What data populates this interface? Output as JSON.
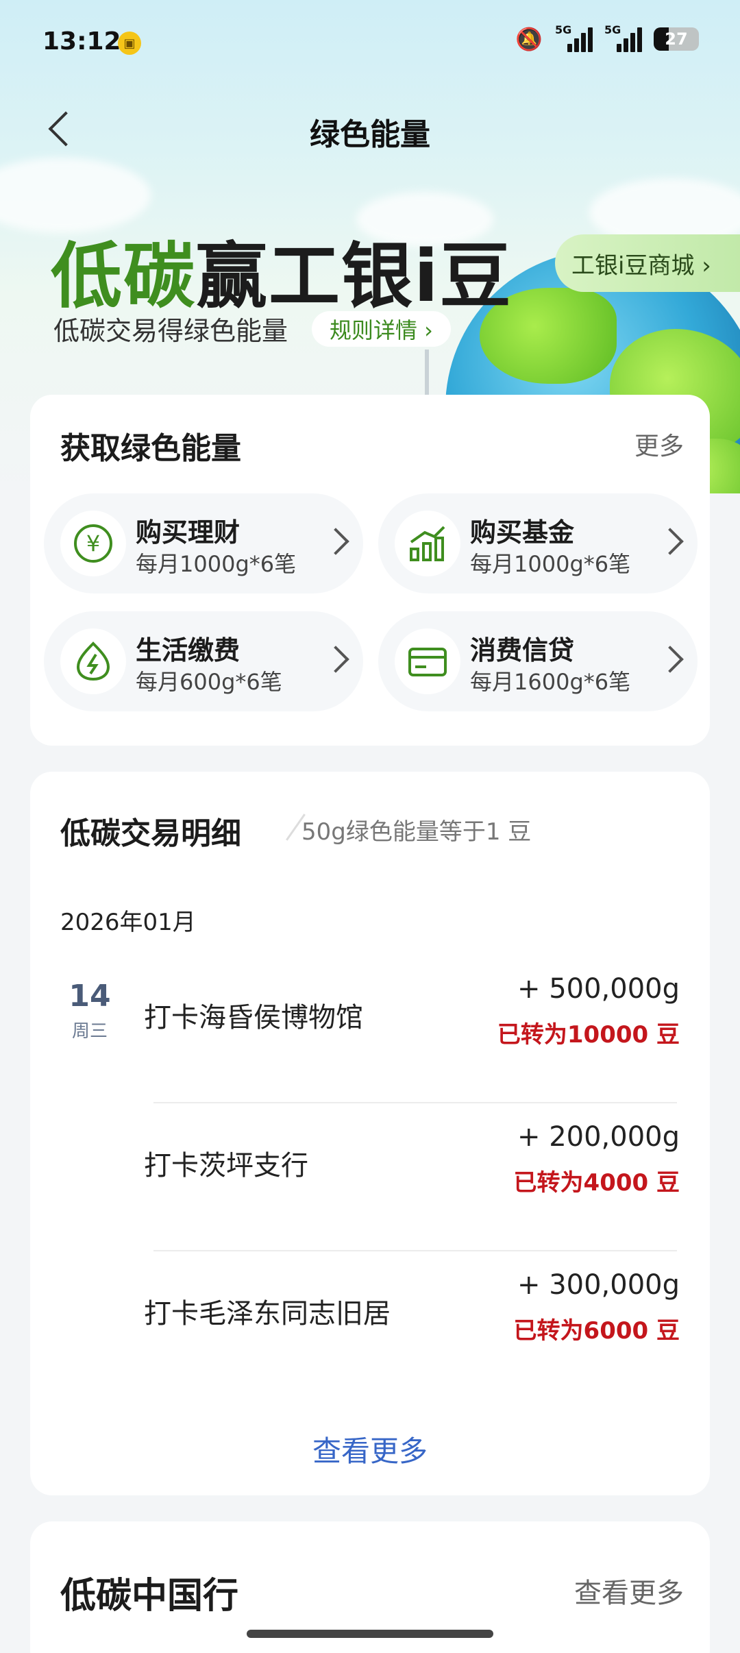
{
  "status_bar": {
    "time": "13:12",
    "network1": "5G",
    "network2": "5G",
    "battery": "27"
  },
  "nav": {
    "title": "绿色能量"
  },
  "hero": {
    "headline_green": "低碳",
    "headline_dark": "赢工银i豆",
    "subtitle": "低碳交易得绿色能量",
    "rules_label": "规则详情 ›",
    "shop_label": "工银i豆商城 ›"
  },
  "earn": {
    "title": "获取绿色能量",
    "more": "更多",
    "tasks": [
      {
        "name": "购买理财",
        "desc": "每月1000g*6笔",
        "icon": "yen-icon"
      },
      {
        "name": "购买基金",
        "desc": "每月1000g*6笔",
        "icon": "chart-up-icon"
      },
      {
        "name": "生活缴费",
        "desc": "每月600g*6笔",
        "icon": "leaf-bolt-icon"
      },
      {
        "name": "消费信贷",
        "desc": "每月1600g*6笔",
        "icon": "card-icon"
      }
    ]
  },
  "details": {
    "title": "低碳交易明细",
    "note": "50g绿色能量等于1 豆",
    "month": "2026年01月",
    "day": "14",
    "weekday": "周三",
    "records": [
      {
        "place": "打卡海昏侯博物馆",
        "amount": "+ 500,000g",
        "converted": "已转为10000 豆"
      },
      {
        "place": "打卡茨坪支行",
        "amount": "+ 200,000g",
        "converted": "已转为4000 豆"
      },
      {
        "place": "打卡毛泽东同志旧居",
        "amount": "+ 300,000g",
        "converted": "已转为6000 豆"
      }
    ],
    "view_more": "查看更多"
  },
  "china_trip": {
    "title": "低碳中国行",
    "more": "查看更多"
  },
  "colors": {
    "brand_green": "#3f8e1f",
    "red": "#c4161c",
    "link_blue": "#3766c7"
  }
}
